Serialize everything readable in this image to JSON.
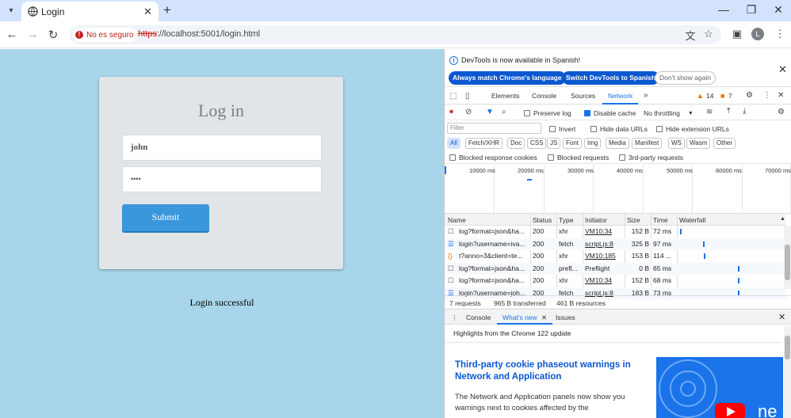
{
  "browser": {
    "tab_title": "Login",
    "security_label": "No es seguro",
    "url_scheme": "https",
    "url_rest": "://localhost:5001/login.html",
    "avatar_letter": "L"
  },
  "page": {
    "heading": "Log in",
    "username_value": "john",
    "password_value": "••••",
    "submit_label": "Submit",
    "status_message": "Login successful"
  },
  "devtools": {
    "info_message": "DevTools is now available in Spanish!",
    "btn_match": "Always match Chrome's language",
    "btn_switch": "Switch DevTools to Spanish",
    "btn_dont_show": "Don't show again",
    "tabs": [
      "Elements",
      "Console",
      "Sources",
      "Network"
    ],
    "warnings_count": "14",
    "errors_count": "7",
    "preserve_log": "Preserve log",
    "disable_cache": "Disable cache",
    "throttling": "No throttling",
    "filter_placeholder": "Filter",
    "invert": "Invert",
    "hide_data_urls": "Hide data URLs",
    "hide_ext_urls": "Hide extension URLs",
    "type_filters": [
      "All",
      "Fetch/XHR",
      "Doc",
      "CSS",
      "JS",
      "Font",
      "Img",
      "Media",
      "Manifest",
      "WS",
      "Wasm",
      "Other"
    ],
    "blocked_cookies": "Blocked response cookies",
    "blocked_requests": "Blocked requests",
    "third_party": "3rd-party requests",
    "overview_ticks": [
      "10000 ms",
      "20000 ms",
      "30000 ms",
      "40000 ms",
      "50000 ms",
      "60000 ms",
      "70000 ms"
    ],
    "columns": [
      "Name",
      "Status",
      "Type",
      "Initiator",
      "Size",
      "Time",
      "Waterfall"
    ],
    "rows": [
      {
        "name": "log?format=json&ha...",
        "status": "200",
        "type": "xhr",
        "initiator": "VM10:34",
        "size": "152 B",
        "time": "72 ms",
        "icon": "doc"
      },
      {
        "name": "login?username=iva...",
        "status": "200",
        "type": "fetch",
        "initiator": "script.js:8",
        "size": "325 B",
        "time": "97 ms",
        "icon": "fetch"
      },
      {
        "name": "t?anno=3&client=te...",
        "status": "200",
        "type": "xhr",
        "initiator": "VM10:185",
        "size": "153 B",
        "time": "114 ...",
        "icon": "js"
      },
      {
        "name": "log?format=json&ha...",
        "status": "200",
        "type": "prefl...",
        "initiator": "Preflight",
        "size": "0 B",
        "time": "65 ms",
        "icon": "doc"
      },
      {
        "name": "log?format=json&ha...",
        "status": "200",
        "type": "xhr",
        "initiator": "VM10:34",
        "size": "152 B",
        "time": "68 ms",
        "icon": "doc"
      },
      {
        "name": "login?username=joh...",
        "status": "200",
        "type": "fetch",
        "initiator": "script.js:8",
        "size": "183 B",
        "time": "73 ms",
        "icon": "fetch"
      }
    ],
    "summary_requests": "7 requests",
    "summary_transferred": "965 B transferred",
    "summary_resources": "461 B resources",
    "drawer_tabs": [
      "Console",
      "What's new",
      "Issues"
    ],
    "highlights": "Highlights from the Chrome 122 update",
    "wn_title": "Third-party cookie phaseout warnings in Network and Application",
    "wn_body": "The Network and Application panels now show you warnings next to cookies affected by the"
  }
}
